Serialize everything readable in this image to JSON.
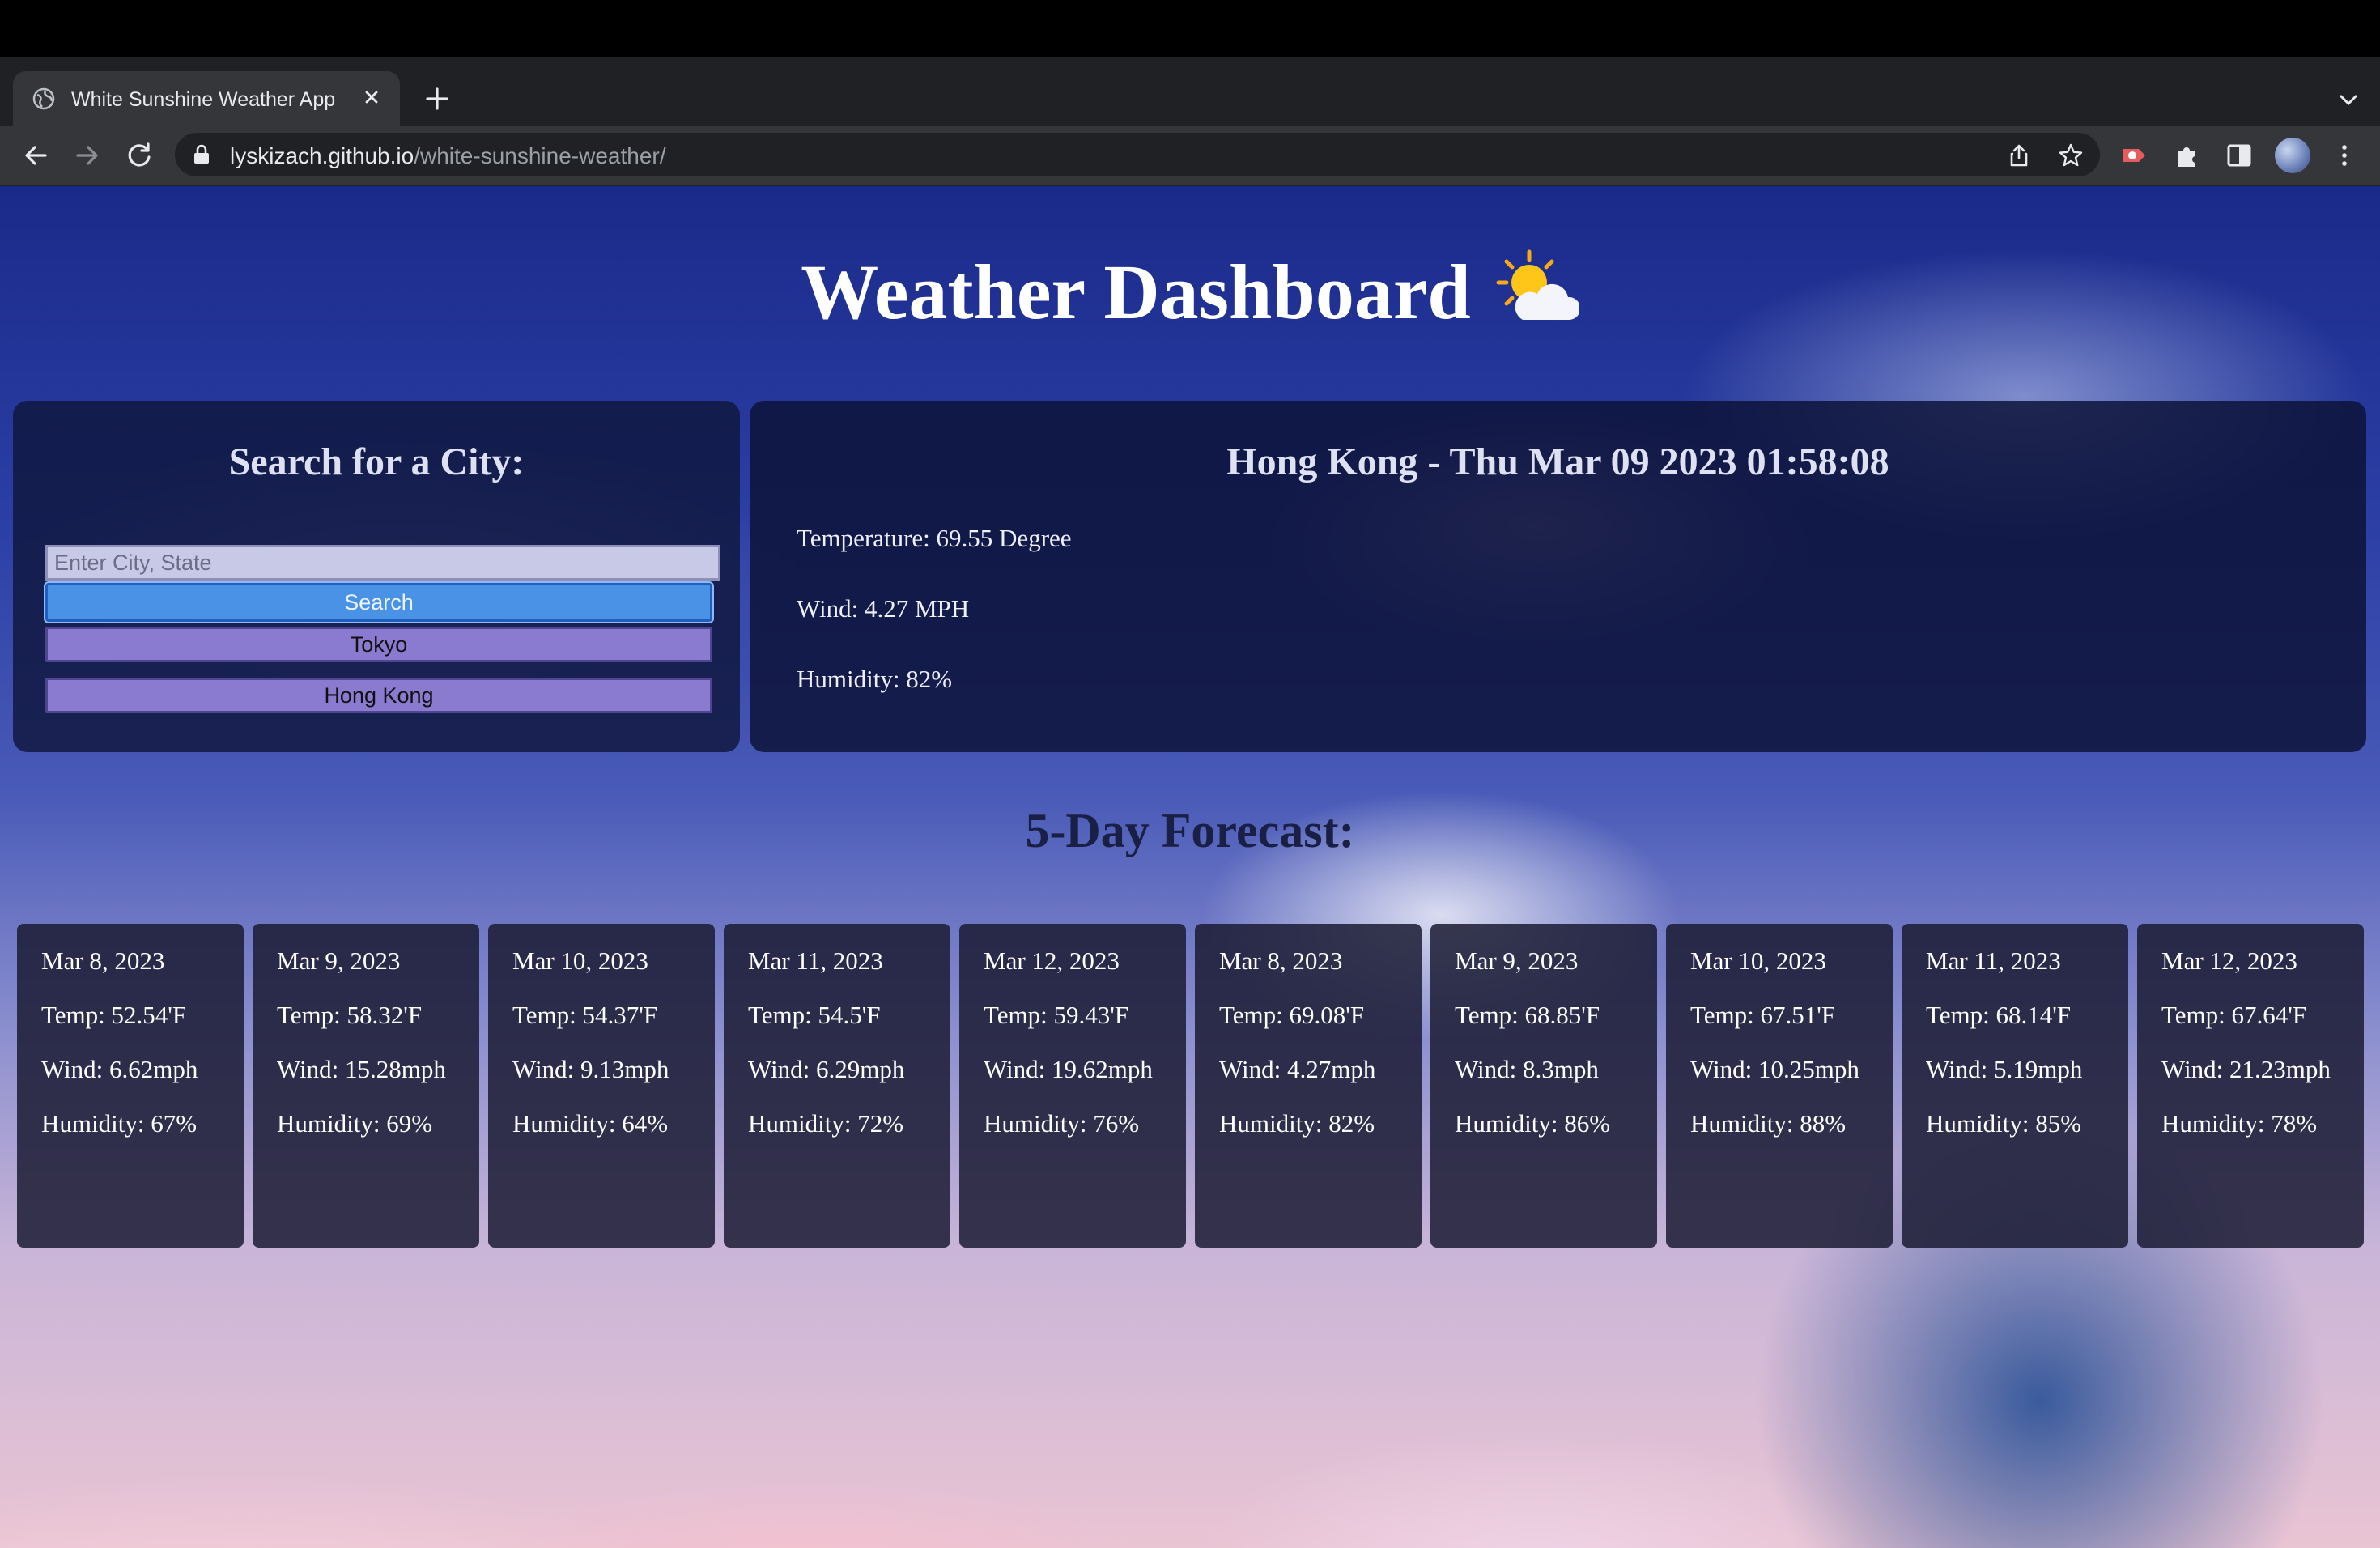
{
  "browser": {
    "tab_title": "White Sunshine Weather App",
    "url_host": "lyskizach.github.io",
    "url_path": "/white-sunshine-weather/"
  },
  "page": {
    "title": "Weather Dashboard",
    "title_icon": "sun-behind-cloud-icon"
  },
  "search": {
    "heading": "Search for a City:",
    "placeholder": "Enter City, State",
    "value": "",
    "button_label": "Search",
    "history": [
      "Tokyo",
      "Hong Kong"
    ]
  },
  "current": {
    "heading": "Hong Kong - Thu Mar 09 2023 01:58:08",
    "temperature": "Temperature: 69.55 Degree",
    "wind": "Wind: 4.27 MPH",
    "humidity": "Humidity: 82%"
  },
  "forecast": {
    "heading": "5-Day Forecast:",
    "days": [
      {
        "date": "Mar 8, 2023",
        "temp": "Temp: 52.54'F",
        "wind": "Wind: 6.62mph",
        "humidity": "Humidity: 67%"
      },
      {
        "date": "Mar 9, 2023",
        "temp": "Temp: 58.32'F",
        "wind": "Wind: 15.28mph",
        "humidity": "Humidity: 69%"
      },
      {
        "date": "Mar 10, 2023",
        "temp": "Temp: 54.37'F",
        "wind": "Wind: 9.13mph",
        "humidity": "Humidity: 64%"
      },
      {
        "date": "Mar 11, 2023",
        "temp": "Temp: 54.5'F",
        "wind": "Wind: 6.29mph",
        "humidity": "Humidity: 72%"
      },
      {
        "date": "Mar 12, 2023",
        "temp": "Temp: 59.43'F",
        "wind": "Wind: 19.62mph",
        "humidity": "Humidity: 76%"
      },
      {
        "date": "Mar 8, 2023",
        "temp": "Temp: 69.08'F",
        "wind": "Wind: 4.27mph",
        "humidity": "Humidity: 82%"
      },
      {
        "date": "Mar 9, 2023",
        "temp": "Temp: 68.85'F",
        "wind": "Wind: 8.3mph",
        "humidity": "Humidity: 86%"
      },
      {
        "date": "Mar 10, 2023",
        "temp": "Temp: 67.51'F",
        "wind": "Wind: 10.25mph",
        "humidity": "Humidity: 88%"
      },
      {
        "date": "Mar 11, 2023",
        "temp": "Temp: 68.14'F",
        "wind": "Wind: 5.19mph",
        "humidity": "Humidity: 85%"
      },
      {
        "date": "Mar 12, 2023",
        "temp": "Temp: 67.64'F",
        "wind": "Wind: 21.23mph",
        "humidity": "Humidity: 78%"
      }
    ]
  }
}
